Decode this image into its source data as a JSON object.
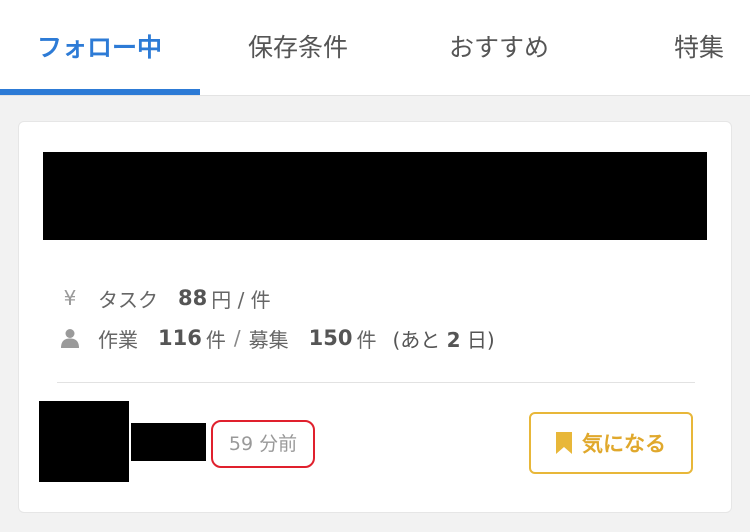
{
  "tabs": [
    {
      "label": "フォロー中",
      "active": true
    },
    {
      "label": "保存条件",
      "active": false
    },
    {
      "label": "おすすめ",
      "active": false
    },
    {
      "label": "特集",
      "active": false
    }
  ],
  "card": {
    "task": {
      "icon": "yen-icon",
      "icon_glyph": "¥",
      "label": "タスク",
      "price": "88",
      "unit": "円 / 件"
    },
    "work": {
      "icon": "person-icon",
      "label": "作業",
      "done": "116",
      "done_unit": "件",
      "separator": "/",
      "recruit_label": "募集",
      "recruit": "150",
      "recruit_unit": "件",
      "remaining_prefix": "(あと",
      "remaining_days": "2",
      "remaining_suffix": "日)"
    },
    "time_ago": "59 分前",
    "favorite_label": "気になる"
  },
  "colors": {
    "accent": "#2d7bd6",
    "favorite": "#e8b739",
    "highlight_ring": "#e0202d"
  }
}
